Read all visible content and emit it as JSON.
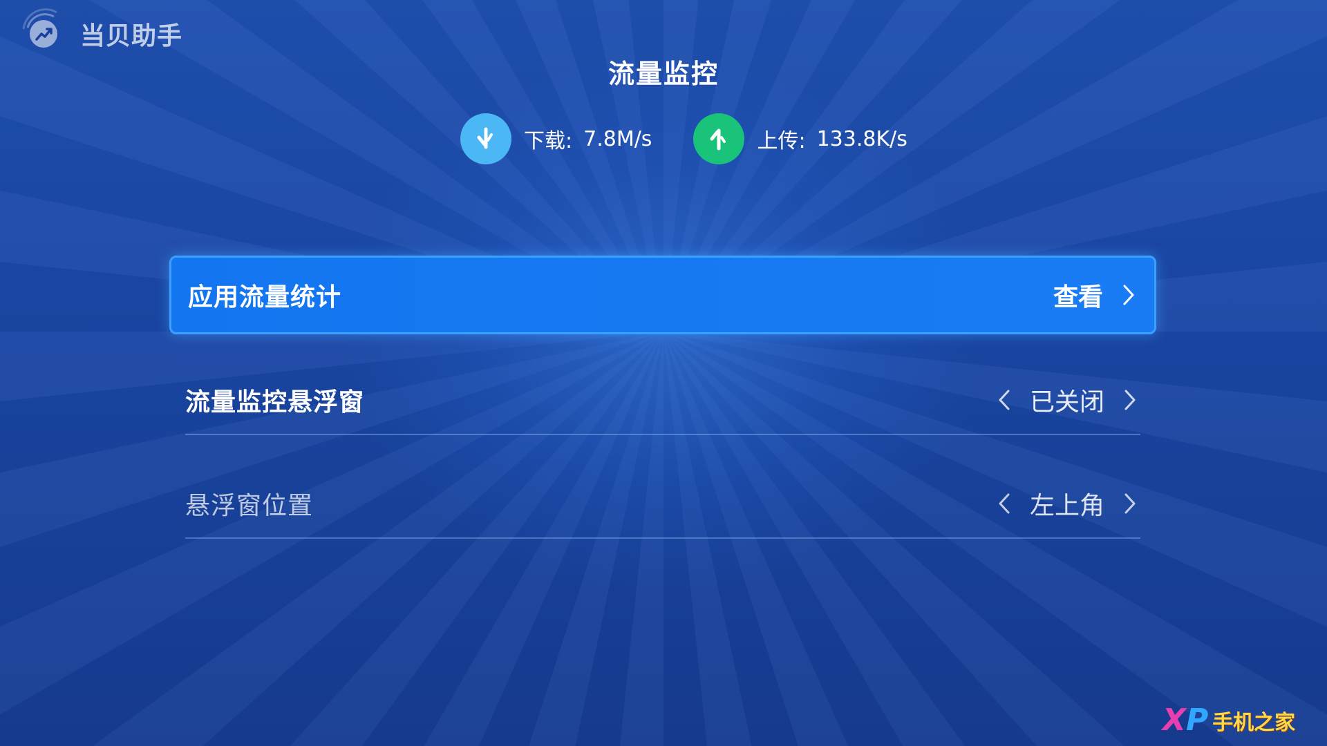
{
  "app": {
    "name": "当贝助手"
  },
  "page": {
    "title": "流量监控"
  },
  "stats": {
    "download": {
      "label": "下载:",
      "value": "7.8M/s",
      "icon": "arrow-down-icon",
      "color": "#4bb8f5"
    },
    "upload": {
      "label": "上传:",
      "value": "133.8K/s",
      "icon": "arrow-up-icon",
      "color": "#19c47a"
    }
  },
  "menu": {
    "items": [
      {
        "label": "应用流量统计",
        "action": "查看",
        "focused": true
      },
      {
        "label": "流量监控悬浮窗",
        "value": "已关闭"
      },
      {
        "label": "悬浮窗位置",
        "value": "左上角"
      }
    ]
  },
  "watermark": {
    "logo_text": "XP",
    "text": "手机之家"
  },
  "colors": {
    "accent": "#1376f0",
    "background": "#1a47a5"
  }
}
